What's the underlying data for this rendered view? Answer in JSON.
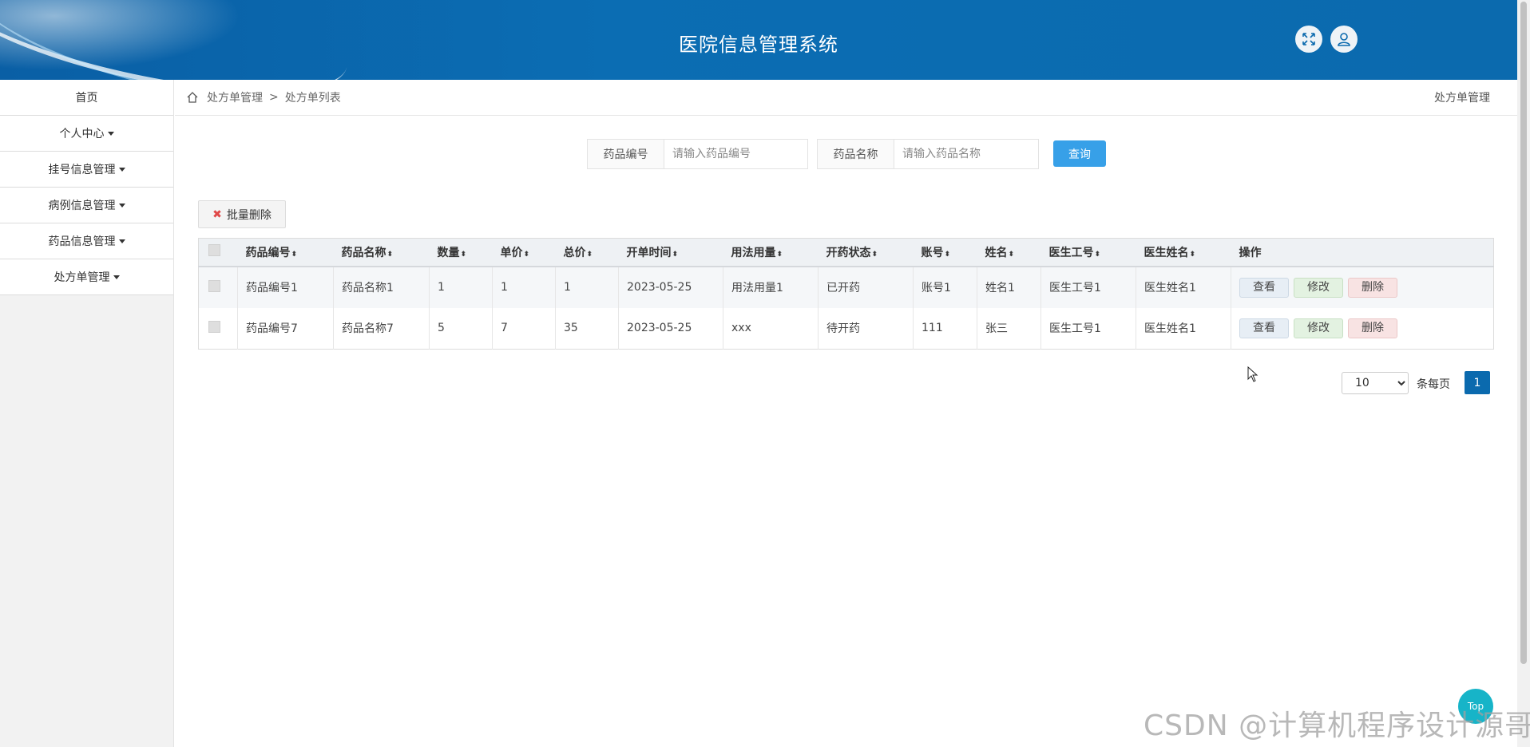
{
  "header": {
    "title": "医院信息管理系统"
  },
  "sidebar": {
    "items": [
      {
        "label": "首页",
        "has_caret": false
      },
      {
        "label": "个人中心",
        "has_caret": true
      },
      {
        "label": "挂号信息管理",
        "has_caret": true
      },
      {
        "label": "病例信息管理",
        "has_caret": true
      },
      {
        "label": "药品信息管理",
        "has_caret": true
      },
      {
        "label": "处方单管理",
        "has_caret": true
      }
    ]
  },
  "breadcrumb": {
    "level1": "处方单管理",
    "separator": ">",
    "level2": "处方单列表",
    "right_label": "处方单管理"
  },
  "search": {
    "field1": {
      "label": "药品编号",
      "placeholder": "请输入药品编号",
      "value": ""
    },
    "field2": {
      "label": "药品名称",
      "placeholder": "请输入药品名称",
      "value": ""
    },
    "query_label": "查询"
  },
  "bulk_delete_label": "批量删除",
  "table": {
    "columns": [
      "药品编号",
      "药品名称",
      "数量",
      "单价",
      "总价",
      "开单时间",
      "用法用量",
      "开药状态",
      "账号",
      "姓名",
      "医生工号",
      "医生姓名",
      "操作"
    ],
    "sort_glyph": "⬍",
    "rows": [
      [
        "药品编号1",
        "药品名称1",
        "1",
        "1",
        "1",
        "2023-05-25",
        "用法用量1",
        "已开药",
        "账号1",
        "姓名1",
        "医生工号1",
        "医生姓名1"
      ],
      [
        "药品编号7",
        "药品名称7",
        "5",
        "7",
        "35",
        "2023-05-25",
        "xxx",
        "待开药",
        "111",
        "张三",
        "医生工号1",
        "医生姓名1"
      ]
    ],
    "actions": {
      "view": "查看",
      "edit": "修改",
      "delete": "删除"
    }
  },
  "pagination": {
    "page_size": "10",
    "per_page_label": "条每页",
    "current_page": "1"
  },
  "top_button": "Top",
  "watermark": "CSDN @计算机程序设计源哥",
  "colors": {
    "header": "#0b6aae",
    "query": "#37a0e8",
    "page_active": "#0b6aae"
  }
}
